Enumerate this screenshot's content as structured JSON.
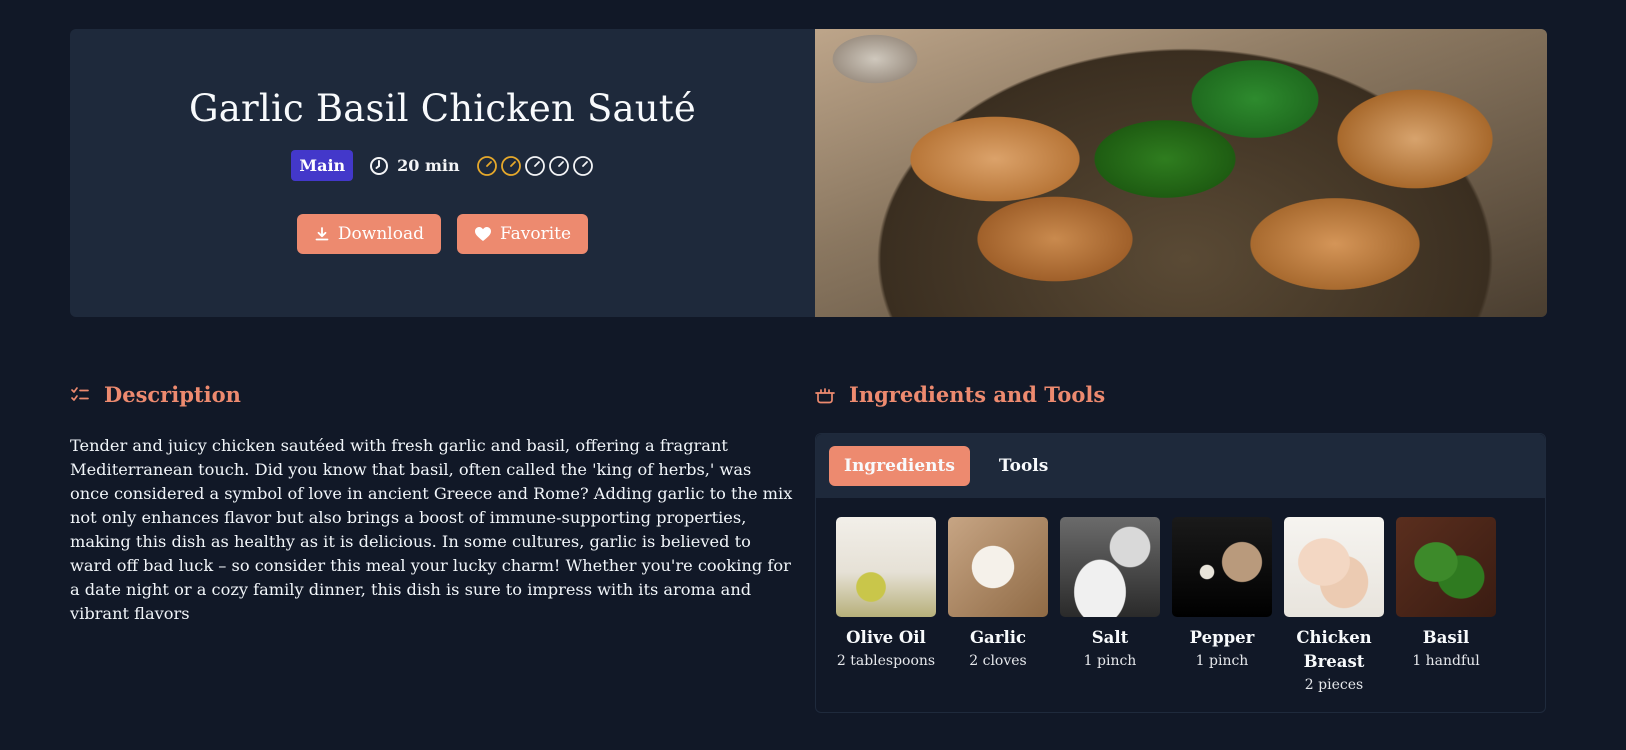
{
  "recipe": {
    "title": "Garlic Basil Chicken Sauté",
    "category": "Main",
    "time": "20 min",
    "difficulty": {
      "level": 2,
      "max": 5,
      "active_color": "#e5a82b",
      "inactive_color": "#f3f4f6"
    }
  },
  "actions": {
    "download_label": "Download",
    "favorite_label": "Favorite"
  },
  "description": {
    "heading": "Description",
    "text": "Tender and juicy chicken sautéed with fresh garlic and basil, offering a fragrant Mediterranean touch. Did you know that basil, often called the 'king of herbs,' was once considered a symbol of love in ancient Greece and Rome? Adding garlic to the mix not only enhances flavor but also brings a boost of immune-supporting properties, making this dish as healthy as it is delicious. In some cultures, garlic is believed to ward off bad luck – so consider this meal your lucky charm! Whether you're cooking for a date night or a cozy family dinner, this dish is sure to impress with its aroma and vibrant flavors"
  },
  "ingredients_section": {
    "heading": "Ingredients and Tools",
    "tabs": [
      {
        "label": "Ingredients",
        "active": true
      },
      {
        "label": "Tools",
        "active": false
      }
    ],
    "items": [
      {
        "name": "Olive Oil",
        "quantity": "2 tablespoons"
      },
      {
        "name": "Garlic",
        "quantity": "2 cloves"
      },
      {
        "name": "Salt",
        "quantity": "1 pinch"
      },
      {
        "name": "Pepper",
        "quantity": "1 pinch"
      },
      {
        "name": "Chicken Breast",
        "quantity": "2 pieces"
      },
      {
        "name": "Basil",
        "quantity": "1 handful"
      }
    ]
  },
  "colors": {
    "accent": "#ed8a6f",
    "badge": "#4338ca",
    "background": "#111827",
    "card": "#1e293b"
  }
}
